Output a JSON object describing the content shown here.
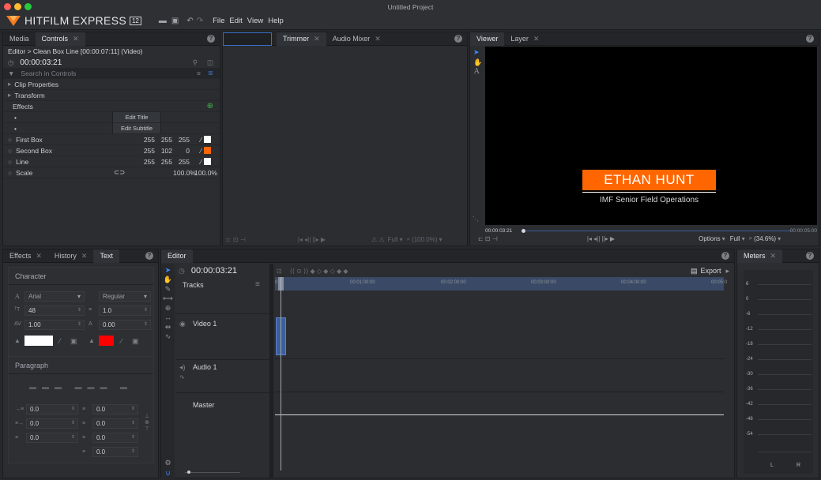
{
  "window": {
    "title": "Untitled Project"
  },
  "app": {
    "logo": "HITFILM EXPRESS",
    "version": "12",
    "menus": [
      "File",
      "Edit",
      "View",
      "Help"
    ]
  },
  "controls": {
    "tabs": [
      "Media",
      "Controls"
    ],
    "breadcrumb": "Editor > Clean Box Line [00:00:07:11] (Video)",
    "timecode": "00:00:03:21",
    "search_placeholder": "Search in Controls",
    "sections": [
      "Clip Properties",
      "Transform",
      "Effects"
    ],
    "buttons": [
      "Edit Title",
      "Edit Subtitle"
    ],
    "params": [
      {
        "name": "First Box",
        "v": [
          "255",
          "255",
          "255"
        ],
        "swatch": "#ffffff"
      },
      {
        "name": "Second Box",
        "v": [
          "255",
          "102",
          "0"
        ],
        "swatch": "#ff6600"
      },
      {
        "name": "Line",
        "v": [
          "255",
          "255",
          "255"
        ],
        "swatch": "#ffffff"
      },
      {
        "name": "Scale",
        "v": [
          "100.0%",
          "100.0%"
        ],
        "swatch": ""
      }
    ]
  },
  "trimmer": {
    "tabs": [
      "Trimmer",
      "Audio Mixer"
    ],
    "zoom": "Full",
    "percent": "(100.0%)"
  },
  "viewer": {
    "tabs": [
      "Viewer",
      "Layer"
    ],
    "lower_third_name": "ETHAN HUNT",
    "lower_third_sub": "IMF Senior Field Operations",
    "time_start": "00:00:03:21",
    "time_end": "00:00:05:00",
    "options": "Options",
    "zoom": "Full",
    "percent": "(34.6%)",
    "accent": "#ff6600"
  },
  "text_panel": {
    "tabs": [
      "Effects",
      "History",
      "Text"
    ],
    "character_label": "Character",
    "font": "Arial",
    "style": "Regular",
    "size": "48",
    "leading": "1.0",
    "tracking": "1.00",
    "kerning": "0.00",
    "fill_color": "#ffffff",
    "stroke_color": "#ff0000",
    "paragraph_label": "Paragraph",
    "para_values": [
      "0.0",
      "0.0",
      "0.0",
      "0.0",
      "0.0",
      "0.0",
      "0.0"
    ]
  },
  "editor": {
    "tab": "Editor",
    "timecode": "00:00:03:21",
    "tracks_label": "Tracks",
    "export": "Export",
    "ruler": [
      "0",
      "00:01:00:00",
      "00:02:00:00",
      "00:03:00:00",
      "00:04:00:00",
      "00:05:0"
    ],
    "tracks": [
      "Video 1",
      "Audio 1",
      "Master"
    ]
  },
  "meters": {
    "tab": "Meters",
    "scale": [
      "6",
      "0",
      "-6",
      "-12",
      "-18",
      "-24",
      "-30",
      "-36",
      "-42",
      "-48",
      "-54"
    ],
    "channels": [
      "L",
      "R"
    ]
  }
}
